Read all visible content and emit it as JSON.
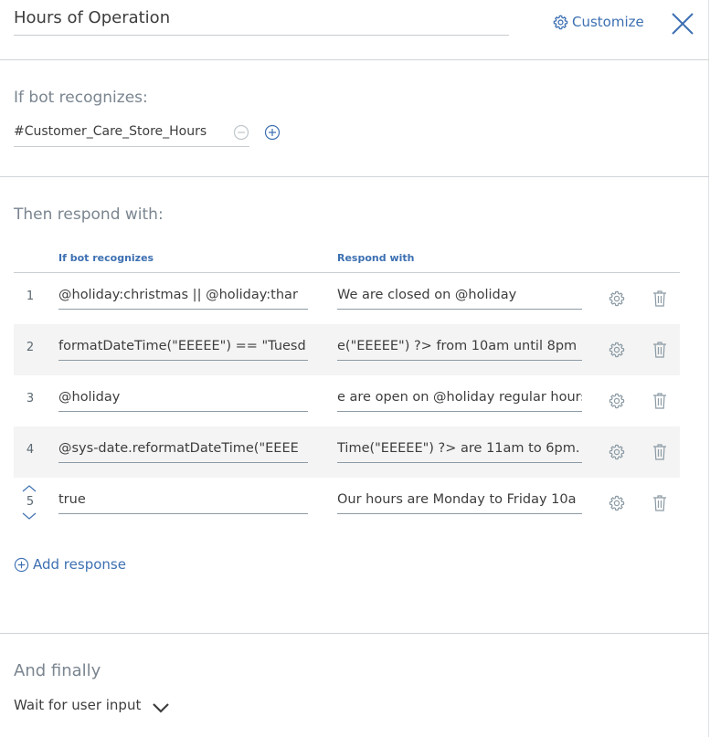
{
  "header": {
    "title": "Hours of Operation",
    "customize_label": "Customize"
  },
  "recognizes_section": {
    "label": "If bot recognizes:",
    "intent_value": "#Customer_Care_Store_Hours"
  },
  "respond_section": {
    "label": "Then respond with:",
    "columns": {
      "condition_header": "If bot recognizes",
      "response_header": "Respond with"
    },
    "rows": [
      {
        "number": "1",
        "condition": "@holiday:christmas || @holiday:thar",
        "response": "We are closed on @holiday"
      },
      {
        "number": "2",
        "condition": "formatDateTime(\"EEEEE\") == \"Tuesd",
        "response": "e(\"EEEEE\") ?> from 10am until 8pm"
      },
      {
        "number": "3",
        "condition": "@holiday",
        "response": "e are open on @holiday regular hours"
      },
      {
        "number": "4",
        "condition": "@sys-date.reformatDateTime(\"EEEE",
        "response": "Time(\"EEEEE\") ?> are 11am to 6pm."
      },
      {
        "number": "5",
        "condition": "true",
        "response": "Our hours are Monday to Friday 10a"
      }
    ],
    "add_response_label": "Add response"
  },
  "finally_section": {
    "label": "And finally",
    "action_value": "Wait for user input"
  },
  "colors": {
    "accent": "#3d70b2",
    "row_shade": "#f4f4f4"
  }
}
